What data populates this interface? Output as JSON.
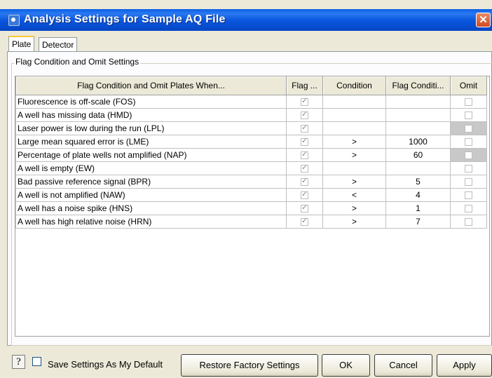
{
  "window": {
    "title": "Analysis Settings for Sample AQ File",
    "close_glyph": "✕"
  },
  "tabs": [
    {
      "label": "Plate"
    },
    {
      "label": "Detector"
    }
  ],
  "group": {
    "title": "Flag Condition and Omit Settings"
  },
  "table": {
    "headers": [
      "Flag Condition and Omit Plates When...",
      "Flag ...",
      "Condition",
      "Flag Conditi...",
      "Omit"
    ],
    "rows": [
      {
        "label": "Fluorescence is off-scale  (FOS)",
        "flag": true,
        "condition": "",
        "value": "",
        "omit": false,
        "omit_disabled": false
      },
      {
        "label": "A well has missing data  (HMD)",
        "flag": true,
        "condition": "",
        "value": "",
        "omit": false,
        "omit_disabled": false
      },
      {
        "label": "Laser power is low during the run  (LPL)",
        "flag": true,
        "condition": "",
        "value": "",
        "omit": false,
        "omit_disabled": true
      },
      {
        "label": "Large mean squared error is  (LME)",
        "flag": true,
        "condition": ">",
        "value": "1000",
        "omit": false,
        "omit_disabled": false
      },
      {
        "label": "Percentage of plate wells not amplified  (NAP)",
        "flag": true,
        "condition": ">",
        "value": "60",
        "omit": false,
        "omit_disabled": true
      },
      {
        "label": "A well is empty  (EW)",
        "flag": true,
        "condition": "",
        "value": "",
        "omit": false,
        "omit_disabled": false
      },
      {
        "label": "Bad passive reference signal  (BPR)",
        "flag": true,
        "condition": ">",
        "value": "5",
        "omit": false,
        "omit_disabled": false
      },
      {
        "label": "A well is not amplified  (NAW)",
        "flag": true,
        "condition": "<",
        "value": "4",
        "omit": false,
        "omit_disabled": false
      },
      {
        "label": "A well has a noise spike  (HNS)",
        "flag": true,
        "condition": ">",
        "value": "1",
        "omit": false,
        "omit_disabled": false
      },
      {
        "label": "A well has high relative noise  (HRN)",
        "flag": true,
        "condition": ">",
        "value": "7",
        "omit": false,
        "omit_disabled": false
      }
    ]
  },
  "footer": {
    "help_label": "?",
    "save_default_label": "Save Settings As My Default",
    "save_default_checked": false,
    "restore_label": "Restore Factory Settings",
    "ok_label": "OK",
    "cancel_label": "Cancel",
    "apply_label": "Apply"
  }
}
